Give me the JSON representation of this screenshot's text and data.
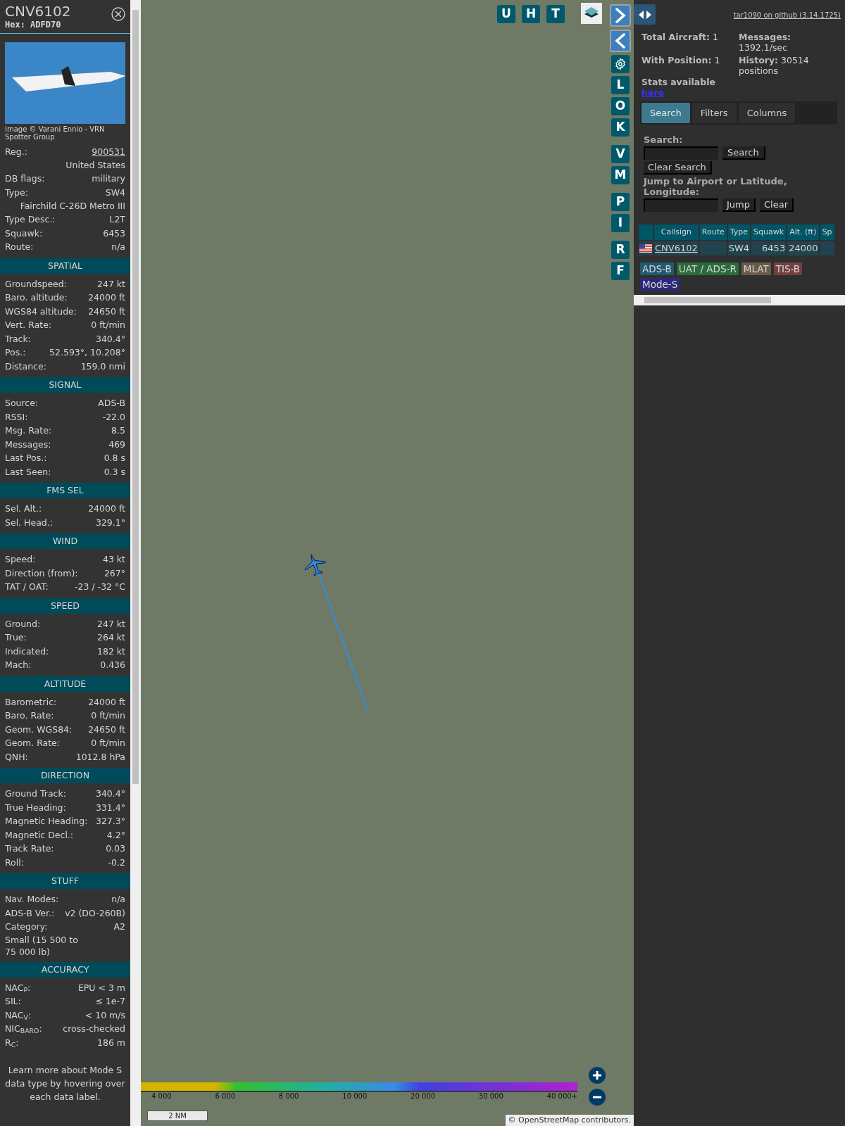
{
  "sidebar": {
    "callsign": "CNV6102",
    "hex": "Hex: ADFD70",
    "photo_credit": "Image © Varani Ennio - VRN Spotter Group",
    "rows": [
      {
        "kind": "link",
        "label": "Reg.:",
        "value": "900531"
      },
      {
        "kind": "value",
        "value": "United States"
      },
      {
        "kind": "pair",
        "label": "DB flags:",
        "value": "military"
      },
      {
        "kind": "pair",
        "label": "Type:",
        "value": "SW4"
      },
      {
        "kind": "value",
        "value": "Fairchild C-26D Metro III"
      },
      {
        "kind": "pair",
        "label": "Type Desc.:",
        "value": "L2T"
      },
      {
        "kind": "pair",
        "label": "Squawk:",
        "value": "6453"
      },
      {
        "kind": "pair",
        "label": "Route:",
        "value": "n/a"
      }
    ],
    "sections": [
      {
        "title": "SPATIAL",
        "rows": [
          {
            "kind": "pair",
            "label": "Groundspeed:",
            "value": "247 kt"
          },
          {
            "kind": "pair",
            "label": "Baro. altitude:",
            "value": "24000 ft"
          },
          {
            "kind": "pair",
            "label": "WGS84 altitude:",
            "value": "24650 ft"
          },
          {
            "kind": "pair",
            "label": "Vert. Rate:",
            "value": "0 ft/min"
          },
          {
            "kind": "pair",
            "label": "Track:",
            "value": "340.4°"
          },
          {
            "kind": "pair",
            "label": "Pos.:",
            "value": "52.593°, 10.208°"
          },
          {
            "kind": "pair",
            "label": "Distance:",
            "value": "159.0 nmi"
          }
        ]
      },
      {
        "title": "SIGNAL",
        "rows": [
          {
            "kind": "pair",
            "label": "Source:",
            "value": "ADS-B"
          },
          {
            "kind": "pair",
            "label": "RSSI:",
            "value": "-22.0"
          },
          {
            "kind": "pair",
            "label": "Msg. Rate:",
            "value": "8.5"
          },
          {
            "kind": "pair",
            "label": "Messages:",
            "value": "469"
          },
          {
            "kind": "pair",
            "label": "Last Pos.:",
            "value": "0.8 s"
          },
          {
            "kind": "pair",
            "label": "Last Seen:",
            "value": "0.3 s"
          }
        ]
      },
      {
        "title": "FMS SEL",
        "rows": [
          {
            "kind": "pair",
            "label": "Sel. Alt.:",
            "value": "24000 ft"
          },
          {
            "kind": "pair",
            "label": "Sel. Head.:",
            "value": "329.1°"
          }
        ]
      },
      {
        "title": "WIND",
        "rows": [
          {
            "kind": "pair",
            "label": "Speed:",
            "value": "43 kt"
          },
          {
            "kind": "pair",
            "label": "Direction (from):",
            "value": "267°"
          },
          {
            "kind": "pair",
            "label": "TAT / OAT:",
            "value": "-23 / -32 °C"
          }
        ]
      },
      {
        "title": "SPEED",
        "rows": [
          {
            "kind": "pair",
            "label": "Ground:",
            "value": "247 kt"
          },
          {
            "kind": "pair",
            "label": "True:",
            "value": "264 kt"
          },
          {
            "kind": "pair",
            "label": "Indicated:",
            "value": "182 kt"
          },
          {
            "kind": "pair",
            "label": "Mach:",
            "value": "0.436"
          }
        ]
      },
      {
        "title": "ALTITUDE",
        "rows": [
          {
            "kind": "pair",
            "label": "Barometric:",
            "value": "24000 ft"
          },
          {
            "kind": "pair",
            "label": "Baro. Rate:",
            "value": "0 ft/min"
          },
          {
            "kind": "pair",
            "label": "Geom. WGS84:",
            "value": "24650 ft"
          },
          {
            "kind": "pair",
            "label": "Geom. Rate:",
            "value": "0 ft/min"
          },
          {
            "kind": "pair",
            "label": "QNH:",
            "value": "1012.8 hPa"
          }
        ]
      },
      {
        "title": "DIRECTION",
        "rows": [
          {
            "kind": "pair",
            "label": "Ground Track:",
            "value": "340.4°"
          },
          {
            "kind": "pair",
            "label": "True Heading:",
            "value": "331.4°"
          },
          {
            "kind": "pair",
            "label": "Magnetic Heading:",
            "value": "327.3°"
          },
          {
            "kind": "pair",
            "label": "Magnetic Decl.:",
            "value": "4.2°"
          },
          {
            "kind": "pair",
            "label": "Track Rate:",
            "value": "0.03"
          },
          {
            "kind": "pair",
            "label": "Roll:",
            "value": "-0.2"
          }
        ]
      },
      {
        "title": "STUFF",
        "rows": [
          {
            "kind": "pair",
            "label": "Nav. Modes:",
            "value": "n/a"
          },
          {
            "kind": "pair",
            "label": "ADS-B Ver.:",
            "value": "v2 (DO-260B)"
          },
          {
            "kind": "pair",
            "label": "Category:",
            "value": "A2"
          },
          {
            "kind": "note",
            "value": "Small (15 500 to 75 000 lb)"
          }
        ]
      },
      {
        "title": "ACCURACY",
        "rows": [
          {
            "kind": "pair",
            "label": "NAC$_{P}$:",
            "value": "EPU < 3 m"
          },
          {
            "kind": "pair",
            "label": "SIL:",
            "value": "≤ 1e-7"
          },
          {
            "kind": "pair",
            "label": "NAC$_{V}$:",
            "value": "< 10 m/s"
          },
          {
            "kind": "pair",
            "label": "NIC$_{BARO}$:",
            "value": "cross-checked"
          },
          {
            "kind": "pair",
            "label": "R$_{C}$:",
            "value": "186 m"
          }
        ]
      }
    ],
    "footer": "Learn more about Mode S data type by hovering over each data label."
  },
  "map": {
    "top_buttons": [
      "U",
      "H",
      "T"
    ],
    "side_buttons": [
      {
        "kind": "arrow-right"
      },
      {
        "kind": "arrow-left"
      },
      {
        "kind": "gear"
      },
      {
        "kind": "letter",
        "label": "L"
      },
      {
        "kind": "letter",
        "label": "O"
      },
      {
        "kind": "letter",
        "label": "K"
      },
      {
        "kind": "letter",
        "label": "V"
      },
      {
        "kind": "letter",
        "label": "M"
      },
      {
        "kind": "letter",
        "label": "P"
      },
      {
        "kind": "letter",
        "label": "I"
      },
      {
        "kind": "letter",
        "label": "R"
      },
      {
        "kind": "letter",
        "label": "F"
      }
    ],
    "altitude_labels": [
      "4 000",
      "6 000",
      "8 000",
      "10 000",
      "20 000",
      "30 000",
      "40 000+"
    ],
    "scale": "2 NM",
    "attribution": "© OpenStreetMap contributors."
  },
  "panel": {
    "version_link": "tar1090 on github (3.14.1725)",
    "stats": [
      {
        "label": "Total Aircraft:",
        "value": "1"
      },
      {
        "label": "Messages:",
        "value": "1392.1/sec"
      },
      {
        "label": "With Position:",
        "value": "1"
      },
      {
        "label": "History:",
        "value": "30514 positions"
      }
    ],
    "stats_note": "Stats available",
    "stats_link": "here",
    "tabs": [
      {
        "label": "Search",
        "selected": true
      },
      {
        "label": "Filters",
        "selected": false
      },
      {
        "label": "Columns",
        "selected": false
      }
    ],
    "search_label": "Search:",
    "search_button": "Search",
    "clear_search_button": "Clear Search",
    "jump_label": "Jump to Airport or Latitude, Longitude:",
    "jump_button": "Jump",
    "clear_button": "Clear",
    "table": {
      "columns": [
        "Callsign",
        "Route",
        "Type",
        "Squawk",
        "Alt. (ft)",
        "Sp"
      ],
      "rows": [
        {
          "callsign": "CNV6102",
          "route": "",
          "type": "SW4",
          "squawk": "6453",
          "altitude": "24000"
        }
      ]
    },
    "legend": [
      {
        "label": "ADS-B",
        "color": "#1f5a6e"
      },
      {
        "label": "UAT / ADS-R",
        "color": "#2a6b3a"
      },
      {
        "label": "MLAT",
        "color": "#6a5a48"
      },
      {
        "label": "TIS-B",
        "color": "#73403f"
      },
      {
        "label": "Mode-S",
        "color": "#2c2a78"
      }
    ]
  }
}
